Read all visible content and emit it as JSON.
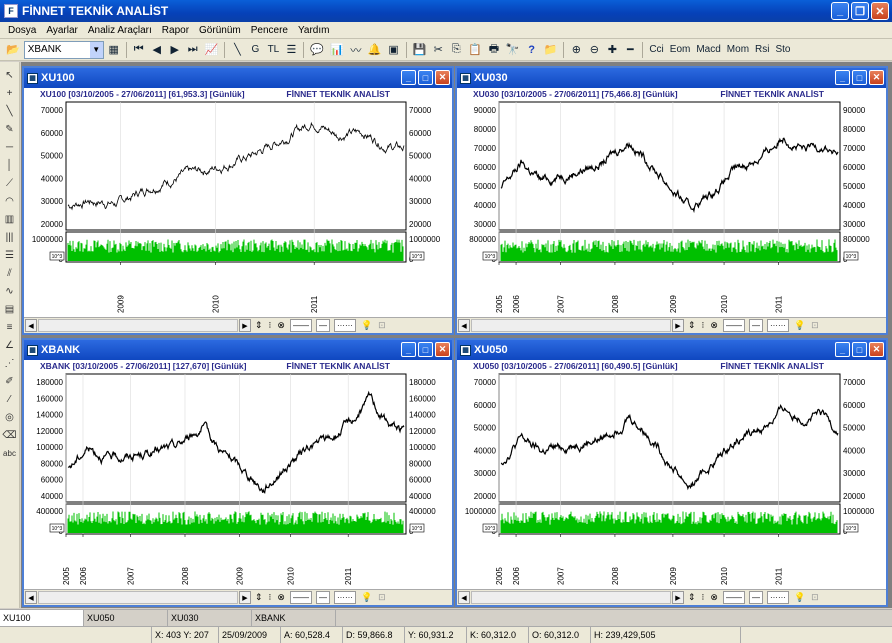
{
  "app": {
    "title": "FİNNET TEKNİK ANALİST"
  },
  "menu": [
    "Dosya",
    "Ayarlar",
    "Analiz Araçları",
    "Rapor",
    "Görünüm",
    "Pencere",
    "Yardım"
  ],
  "toolbar": {
    "symbol_combo": "XBANK",
    "currency": "TL",
    "g_label": "G",
    "indicators": [
      "Cci",
      "Eom",
      "Macd",
      "Mom",
      "Rsi",
      "Sto"
    ]
  },
  "windows": [
    {
      "title": "XU100",
      "header": "XU100  [03/10/2005 - 27/06/2011]  [61,953.3]  [Günlük]",
      "brand": "FİNNET TEKNİK ANALİST",
      "price_ticks": [
        "70000",
        "60000",
        "50000",
        "40000",
        "30000",
        "20000"
      ],
      "vol_ticks": [
        "1000000",
        "0"
      ],
      "year_ticks": [
        "2009",
        "2010",
        "2011"
      ],
      "vol_unit": "10^3",
      "line_color": "#000000",
      "style_dd1": "——",
      "style_dd2": "—",
      "style_dd3": "······"
    },
    {
      "title": "XU030",
      "header": "XU030  [03/10/2005 - 27/06/2011]  [75,466.8]  [Günlük]",
      "brand": "FİNNET TEKNİK ANALİST",
      "price_ticks": [
        "90000",
        "80000",
        "70000",
        "60000",
        "50000",
        "40000",
        "30000"
      ],
      "vol_ticks": [
        "800000",
        "0"
      ],
      "year_ticks": [
        "2005",
        "2006",
        "2007",
        "2008",
        "2009",
        "2010",
        "2011"
      ],
      "vol_unit": "10^3",
      "line_color": "#000000",
      "style_dd1": "——",
      "style_dd2": "—",
      "style_dd3": "······"
    },
    {
      "title": "XBANK",
      "header": "XBANK  [03/10/2005 - 27/06/2011]  [127,670]  [Günlük]",
      "brand": "FİNNET TEKNİK ANALİST",
      "price_ticks": [
        "180000",
        "160000",
        "140000",
        "120000",
        "100000",
        "80000",
        "60000",
        "40000"
      ],
      "vol_ticks": [
        "400000",
        "0"
      ],
      "year_ticks": [
        "2005",
        "2006",
        "2007",
        "2008",
        "2009",
        "2010",
        "2011"
      ],
      "vol_unit": "10^3",
      "line_color": "#000000",
      "style_dd1": "——",
      "style_dd2": "—",
      "style_dd3": "······"
    },
    {
      "title": "XU050",
      "header": "XU050  [03/10/2005 - 27/06/2011]  [60,490.5]  [Günlük]",
      "brand": "FİNNET TEKNİK ANALİST",
      "price_ticks": [
        "70000",
        "60000",
        "50000",
        "40000",
        "30000",
        "20000"
      ],
      "vol_ticks": [
        "1000000",
        "0"
      ],
      "year_ticks": [
        "2005",
        "2006",
        "2007",
        "2008",
        "2009",
        "2010",
        "2011"
      ],
      "vol_unit": "10^3",
      "line_color": "#000000",
      "style_dd1": "——",
      "style_dd2": "—",
      "style_dd3": "······"
    }
  ],
  "taskbar": [
    "XU100",
    "XU050",
    "XU030",
    "XBANK"
  ],
  "status": {
    "xy": "X: 403 Y: 207",
    "date": "25/09/2009",
    "a": "A: 60,528.4",
    "d": "D: 59,866.8",
    "y": "Y: 60,931.2",
    "k": "K: 60,312.0",
    "o": "O: 60,312.0",
    "h": "H: 239,429,505"
  },
  "colors": {
    "volume": "#00c000",
    "title_blue": "#0f47c0",
    "header_text": "#2a2a8c"
  }
}
